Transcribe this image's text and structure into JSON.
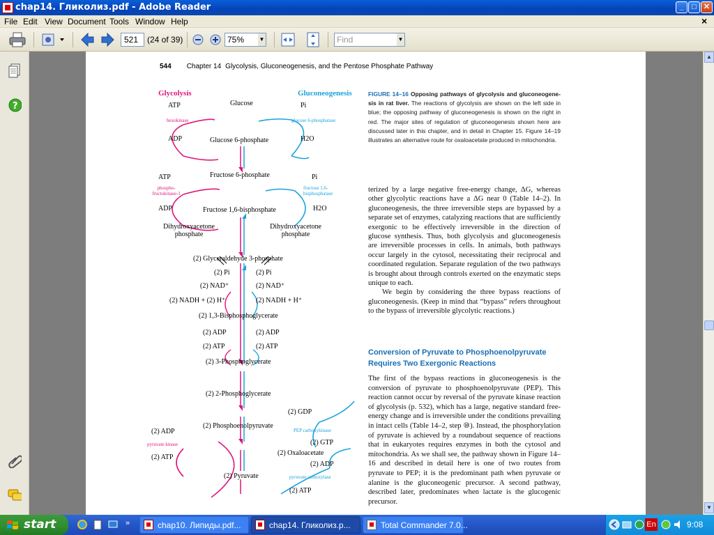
{
  "window": {
    "title": "chap14. Гликолиз.pdf - Adobe Reader",
    "min_label": "_",
    "max_label": "□",
    "close_label": "✕"
  },
  "menu": {
    "items": [
      "File",
      "Edit",
      "View",
      "Document",
      "Tools",
      "Window",
      "Help"
    ],
    "close_doc": "×"
  },
  "toolbar": {
    "page_value": "521",
    "page_count": "(24 of 39)",
    "zoom_value": "75%",
    "find_placeholder": "Find"
  },
  "page": {
    "page_number": "544",
    "chapter": "Chapter 14",
    "chapter_title": "Glycolysis, Gluconeogenesis, and the Pentose Phosphate Pathway",
    "caption": {
      "label": "FIGURE 14–16",
      "title": "Opposing pathways of glycolysis and gluconeogene-sis in rat liver.",
      "text": "The reactions of glycolysis are shown on the left side in blue; the opposing pathway of gluconeogenesis is shown on the right in red. The major sites of regulation of gluconeogenesis shown here are discussed later in this chapter, and in detail in Chapter 15. Figure 14–19 illustrates an alternative route for oxaloacetate produced in mitochondria."
    },
    "body1": [
      "terized by a large negative free-energy change, ΔG, whereas other glycolytic reactions have a ΔG near 0 (Table 14–2). In gluconeogenesis, the three irreversible steps are bypassed by a separate set of enzymes, catalyzing reactions that are sufficiently exergonic to be effectively irreversible in the direction of glucose synthesis. Thus, both glycolysis and gluconeogenesis are irreversible processes in cells. In animals, both pathways occur largely in the cytosol, necessitating their reciprocal and coordinated regulation. Separate regulation of the two pathways is brought about through controls exerted on the enzymatic steps unique to each.",
      "We begin by considering the three bypass reactions of gluconeogenesis. (Keep in mind that “bypass” refers throughout to the bypass of irreversible glycolytic reactions.)"
    ],
    "section_heading": "Conversion of Pyruvate to Phosphoenolpyruvate Requires Two Exergonic Reactions",
    "body2": "The first of the bypass reactions in gluconeogenesis is the conversion of pyruvate to phosphoenolpyruvate (PEP). This reaction cannot occur by reversal of the pyruvate kinase reaction of glycolysis (p. 532), which has a large, negative standard free-energy change and is irreversible under the conditions prevailing in intact cells (Table 14–2, step ⑩). Instead, the phosphorylation of pyruvate is achieved by a roundabout sequence of reactions that in eukaryotes requires enzymes in both the cytosol and mitochondria. As we shall see, the pathway shown in Figure 14–16 and described in detail here is one of two routes from pyruvate to PEP; it is the predominant path when pyruvate or alanine is the gluconeogenic precursor. A second pathway, described later, predominates when lactate is the glucogenic precursor."
  },
  "diagram": {
    "glycolysis": "Glycolysis",
    "gluconeogenesis": "Gluconeogenesis",
    "glucose": "Glucose",
    "g6p": "Glucose 6-phosphate",
    "atp": "ATP",
    "adp": "ADP",
    "pi": "Pi",
    "h2o": "H2O",
    "hexokinase": "hexokinase",
    "g6pase": "glucose 6-phosphatase",
    "f6p": "Fructose 6-phosphate",
    "f16bp": "Fructose 1,6-bisphosphate",
    "pfk": "phospho-fructokinase-1",
    "fbpase": "fructose 1,6-bisphosphatase",
    "dhap_left": "Dihydroxyacetone phosphate",
    "dhap_right": "Dihydroxyacetone phosphate",
    "g3p": "(2) Glyceraldehyde 3-phosphate",
    "pi2_l": "(2) Pi",
    "pi2_r": "(2) Pi",
    "nad_l": "(2) NAD⁺",
    "nad_r": "(2) NAD⁺",
    "nadh_l": "(2) NADH + (2) H⁺",
    "nadh_r": "(2) NADH + H⁺",
    "bpg": "(2) 1,3-Bisphosphoglycerate",
    "adp2_l": "(2) ADP",
    "adp2_r": "(2) ADP",
    "atp2_l": "(2) ATP",
    "atp2_r": "(2) ATP",
    "pg3": "(2) 3-Phosphoglycerate",
    "pg2": "(2) 2-Phosphoglycerate",
    "pep": "(2) Phosphoenolpyruvate",
    "gdp": "(2) GDP",
    "pepck": "PEP carboxykinase",
    "gtp": "(2) GTP",
    "oaa": "(2) Oxaloacetate",
    "adp_pc": "(2) ADP",
    "pc": "pyruvate carboxylase",
    "atp_pc": "(2) ATP",
    "pyruvate": "(2) Pyruvate",
    "adp_pk": "(2) ADP",
    "pk": "pyruvate kinase",
    "atp_pk": "(2) ATP"
  },
  "taskbar": {
    "start": "start",
    "tasks": [
      "chap10. Липиды.pdf...",
      "chap14. Гликолиз.p...",
      "Total Commander 7.0..."
    ],
    "lang": "En",
    "clock": "9:08"
  },
  "colors": {
    "glycolysis": "#e0157a",
    "gluconeogenesis": "#1aa3d9",
    "caption_label": "#1a6fb5"
  }
}
